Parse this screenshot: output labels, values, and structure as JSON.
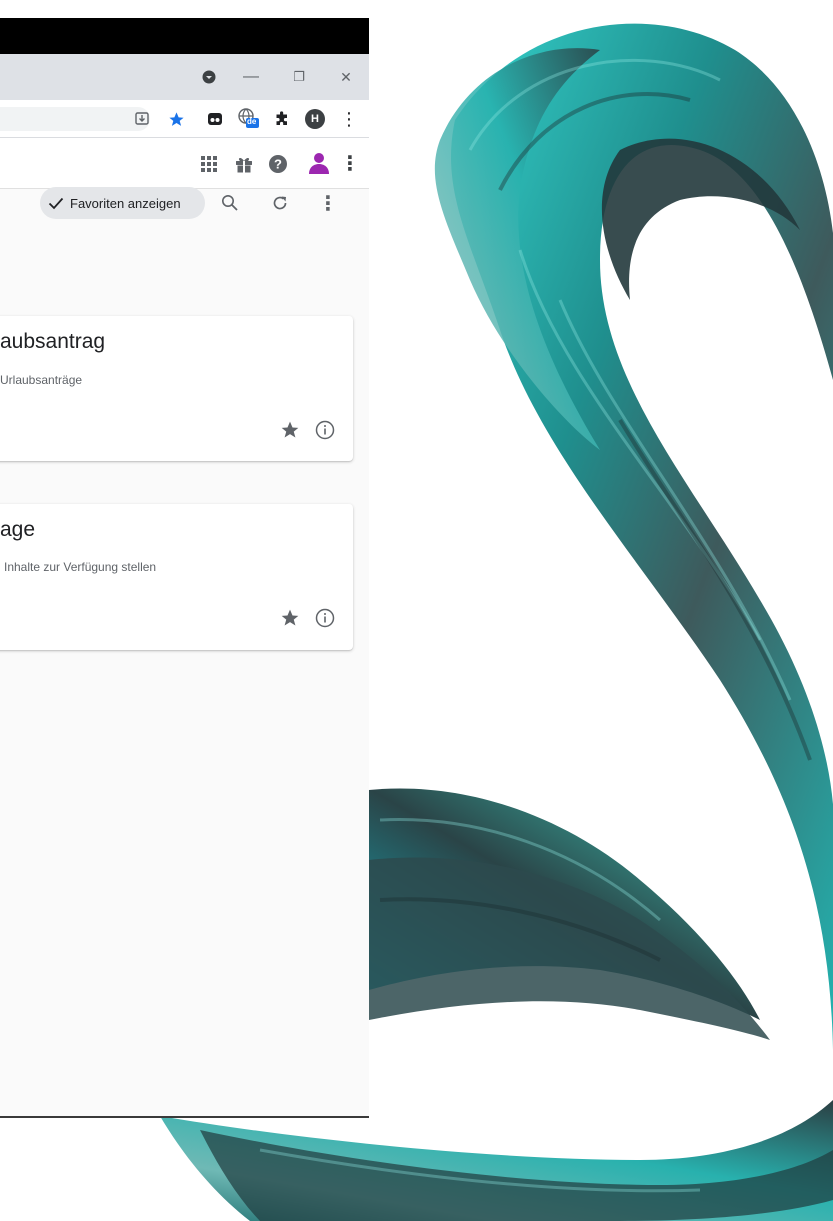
{
  "window": {
    "controls": {
      "minimize": "—",
      "restore": "❐",
      "close": "✕"
    }
  },
  "toolbar": {
    "icons": [
      "install-icon",
      "bookmark-star-icon",
      "extension-tile-icon",
      "translate-icon",
      "extensions-puzzle-icon",
      "profile-avatar",
      "browser-menu-icon"
    ],
    "profile_initial": "H",
    "translate_badge": "de"
  },
  "appbar": {
    "icons": [
      "apps-grid-icon",
      "gift-icon",
      "help-icon",
      "user-icon",
      "more-vert-icon"
    ]
  },
  "page": {
    "favorites_chip_label": "Favoriten anzeigen",
    "search_icon": "search-icon",
    "refresh_icon": "refresh-icon",
    "more_icon": "more-vert-icon"
  },
  "cards": [
    {
      "title": "aubsantrag",
      "subtitle": "Urlaubsanträge"
    },
    {
      "title": "age",
      "subtitle": "Inhalte zur Verfügung stellen"
    }
  ],
  "colors": {
    "titlebar": "#000000",
    "tabstrip": "#dee1e6",
    "star_active": "#1a73e8",
    "profile_purple": "#9c27b0",
    "swirl_teal": "#2fc9c4",
    "swirl_dark": "#2c3e40"
  }
}
